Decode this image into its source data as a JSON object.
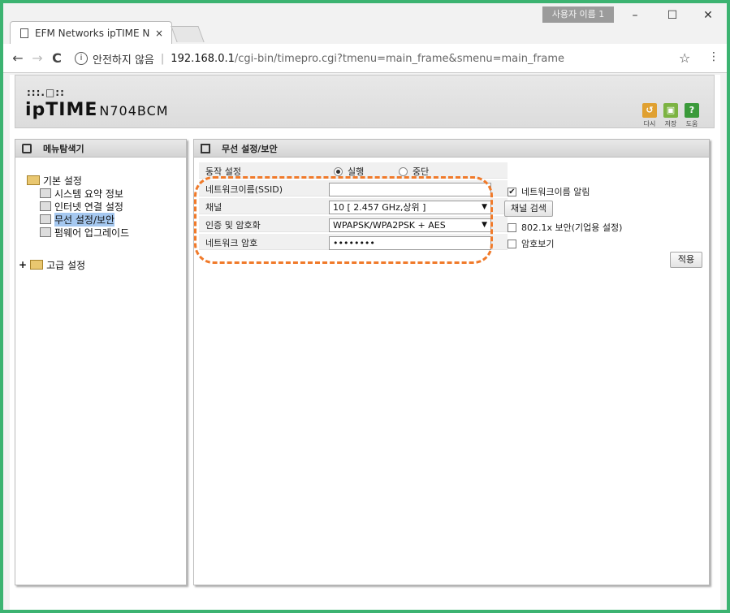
{
  "browser": {
    "tab_title": "EFM Networks ipTIME N",
    "tab_close": "×",
    "profile_name": "사용자 이름 1",
    "win_min": "–",
    "win_max": "☐",
    "win_close": "✕",
    "back": "←",
    "forward": "→",
    "reload": "C",
    "security_text": "안전하지 않음",
    "url_host": "192.168.0.1",
    "url_path": "/cgi-bin/timepro.cgi?tmenu=main_frame&smenu=main_frame",
    "star": "☆",
    "menu": "⋮"
  },
  "header": {
    "logo_dots": ":::.□::",
    "logo_brand": "ipTIME",
    "logo_model": "N704BCM",
    "buttons": [
      {
        "label": "다시",
        "glyph": "↺",
        "color": "#e0a030"
      },
      {
        "label": "저장",
        "glyph": "▣",
        "color": "#7cb342"
      },
      {
        "label": "도움",
        "glyph": "?",
        "color": "#3a9a3a"
      }
    ]
  },
  "side": {
    "title": "메뉴탐색기",
    "groups": [
      {
        "label": "기본 설정",
        "items": [
          "시스템 요약 정보",
          "인터넷 연결 설정",
          "무선 설정/보안",
          "펌웨어 업그레이드"
        ],
        "selected": 2
      },
      {
        "label": "고급 설정",
        "prefix": "+"
      }
    ]
  },
  "main": {
    "title": "무선 설정/보안",
    "fields": {
      "operation_label": "동작 설정",
      "operation_on": "실행",
      "operation_off": "중단",
      "ssid_label": "네트워크이름(SSID)",
      "ssid_value": "",
      "ssid_broadcast": "네트워크이름 알림",
      "channel_label": "채널",
      "channel_value": "10 [ 2.457 GHz,상위 ]",
      "channel_scan": "채널 검색",
      "auth_label": "인증 및 암호화",
      "auth_value": "WPAPSK/WPA2PSK + AES",
      "auth_8021x": "802.1x 보안(기업용 설정)",
      "password_label": "네트워크 암호",
      "password_value": "••••••••",
      "show_password": "암호보기",
      "apply": "적용"
    }
  }
}
